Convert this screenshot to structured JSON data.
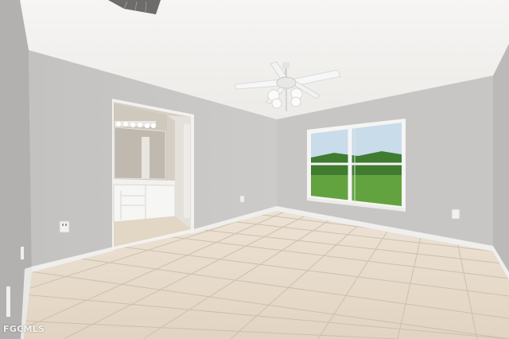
{
  "photo": {
    "subject": "empty-room",
    "watermark": "FGCMLS"
  },
  "colors": {
    "ceiling": "#f3f2f0",
    "wall_left": "#b9b7b5",
    "wall_back": "#c9c7c5",
    "wall_right": "#bebcba",
    "baseboard": "#f2f2f0",
    "floor": "#e6d9c8",
    "grout": "#cdbfae",
    "window_frame": "#f4f4f4",
    "lawn": "#5c9c3b",
    "trees": "#3e7a2e",
    "sky": "#c9dcea",
    "vanity": "#f4f4f2",
    "bath_wall": "#cfc9bf"
  },
  "icons": [
    "ceiling-fan-icon",
    "ac-vent-icon",
    "outlet-icon",
    "vanity-light-icon"
  ]
}
